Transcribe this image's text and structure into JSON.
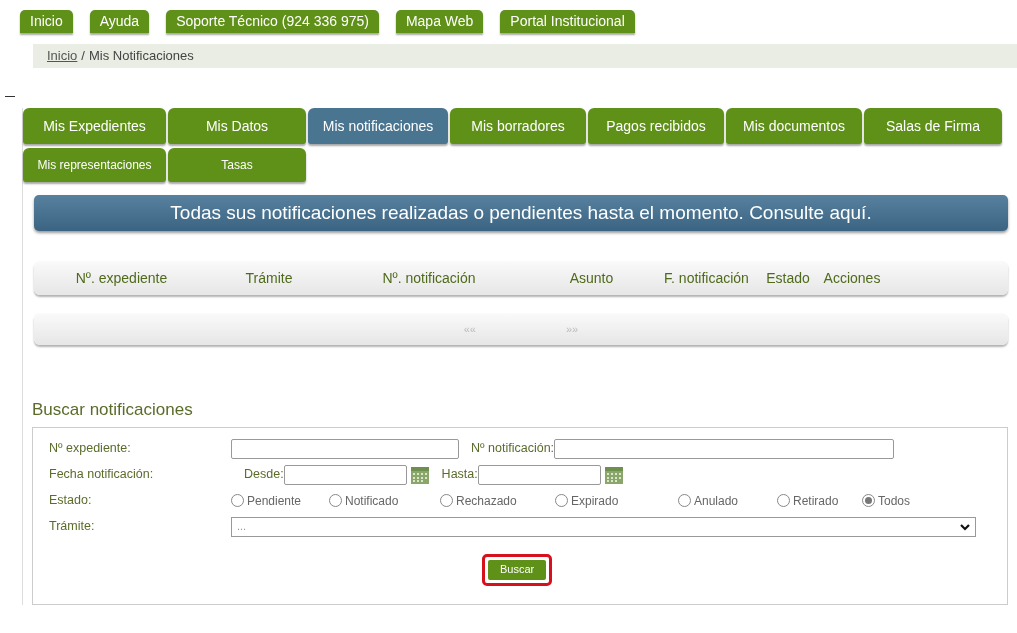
{
  "top_nav": [
    {
      "label": "Inicio"
    },
    {
      "label": "Ayuda"
    },
    {
      "label": "Soporte Técnico (924 336 975)"
    },
    {
      "label": "Mapa Web"
    },
    {
      "label": "Portal Institucional"
    }
  ],
  "breadcrumb": {
    "items": [
      {
        "label": "Inicio",
        "kind": "link"
      },
      {
        "label": "Mis Notificaciones",
        "kind": "current"
      }
    ],
    "separator": "/"
  },
  "tab_rows": [
    {
      "tabs": [
        {
          "label": "Mis Expedientes",
          "selected": false
        },
        {
          "label": "Mis Datos",
          "selected": false
        },
        {
          "label": "Mis notificaciones",
          "selected": true
        },
        {
          "label": "Mis borradores",
          "selected": false
        },
        {
          "label": "Pagos recibidos",
          "selected": false
        },
        {
          "label": "Mis documentos",
          "selected": false
        },
        {
          "label": "Salas de Firma",
          "selected": false
        }
      ]
    },
    {
      "tabs": [
        {
          "label": "Mis representaciones",
          "selected": false
        },
        {
          "label": "Tasas",
          "selected": false
        }
      ]
    }
  ],
  "banner": "Todas sus notificaciones realizadas o pendientes hasta el momento. Consulte aquí.",
  "table": {
    "columns": [
      "Nº. expediente",
      "Trámite",
      "Nº. notificación",
      "Asunto",
      "F. notificación",
      "Estado",
      "Acciones"
    ]
  },
  "pager": {
    "prev": "««",
    "next": "»»"
  },
  "search": {
    "title": "Buscar notificaciones",
    "expediente_label": "Nº expediente:",
    "notificacion_label": "Nº notificación:",
    "fecha_label": "Fecha notificación:",
    "desde_label": "Desde:",
    "hasta_label": "Hasta:",
    "estado_label": "Estado:",
    "estado_options": [
      {
        "label": "Pendiente",
        "selected": false
      },
      {
        "label": "Notificado",
        "selected": false
      },
      {
        "label": "Rechazado",
        "selected": false
      },
      {
        "label": "Expirado",
        "selected": false
      },
      {
        "label": "Anulado",
        "selected": false
      },
      {
        "label": "Retirado",
        "selected": false
      },
      {
        "label": "Todos",
        "selected": true
      }
    ],
    "tramite_label": "Trámite:",
    "tramite_value": "...",
    "button": {
      "label": "Buscar",
      "highlighted": true
    }
  }
}
